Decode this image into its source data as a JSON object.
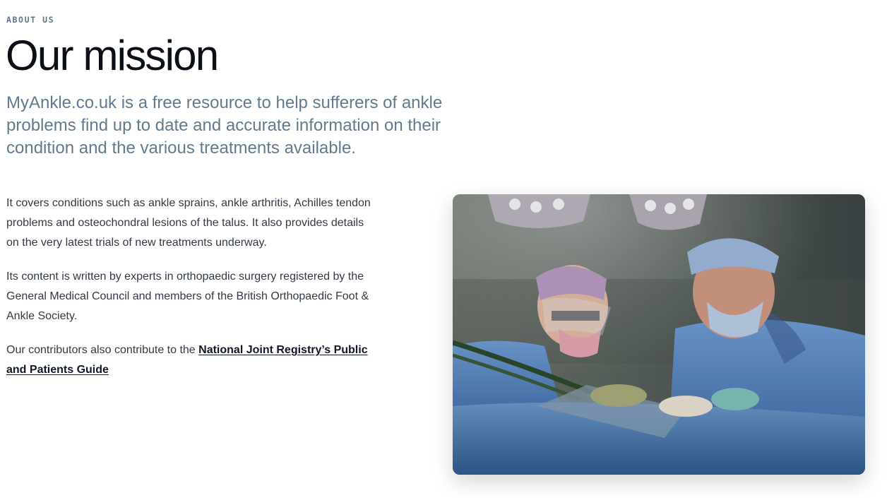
{
  "section": {
    "eyebrow": "ABOUT US",
    "title": "Our mission",
    "lead": "MyAnkle.co.uk is a free resource to help sufferers of ankle problems find up to date and accurate information on their condition and the various treatments available."
  },
  "body": {
    "paragraph_1": "It covers conditions such as ankle sprains, ankle arthritis, Achilles tendon problems and osteochondral lesions of the talus. It also provides details on the very latest trials of new treatments underway.",
    "paragraph_2": "Its content is written by experts in orthopaedic surgery registered by the General Medical Council and members of the British Orthopaedic Foot & Ankle Society.",
    "paragraph_3_prefix": "Our contributors also contribute to the ",
    "paragraph_3_link": "National Joint Registry’s Public and Patients Guide"
  },
  "image": {
    "subject": "surgeons-operating-photo"
  },
  "colors": {
    "eyebrow": "#5f7388",
    "title": "#0b0f17",
    "lead": "#62798f",
    "body_text": "#323a45",
    "link": "#111827",
    "scrub_blue": "#5b86c4"
  }
}
